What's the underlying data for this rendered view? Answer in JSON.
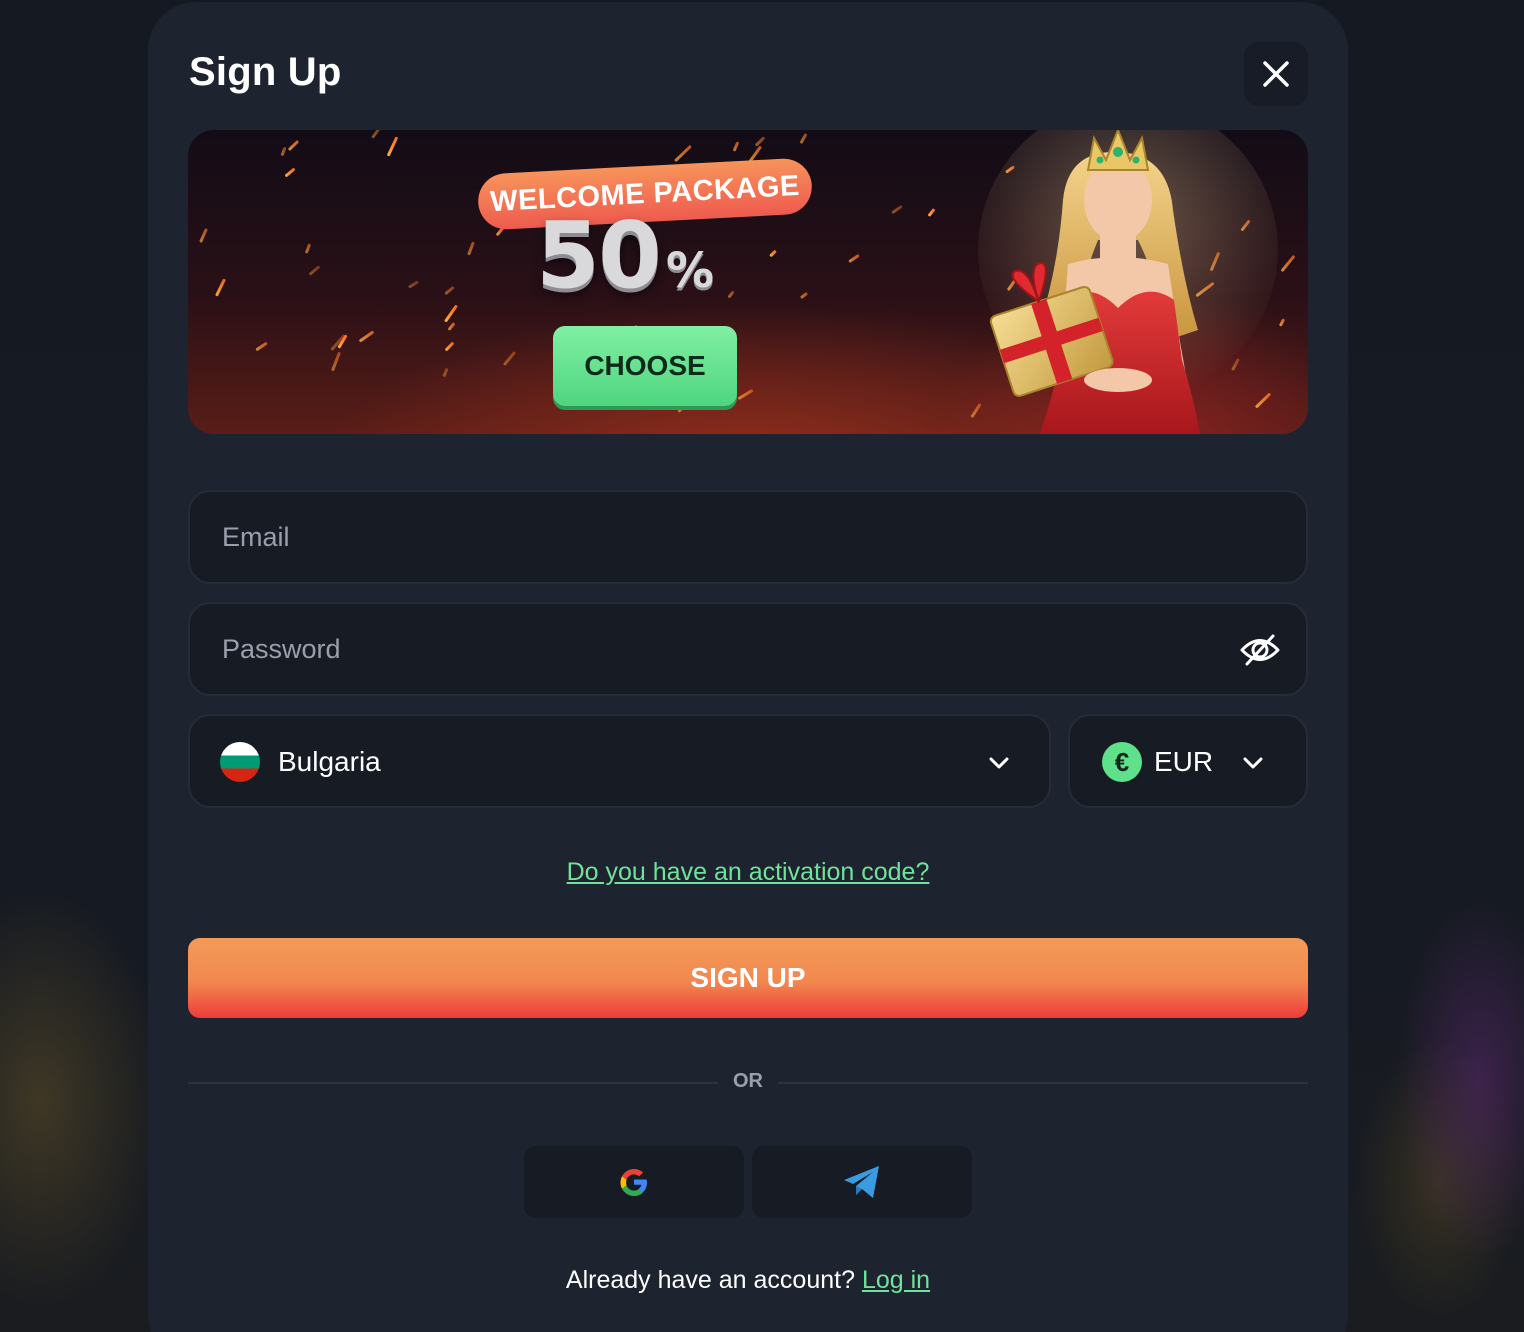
{
  "dialog": {
    "title": "Sign Up",
    "close_icon": "close-icon"
  },
  "banner": {
    "ribbon_text": "WELCOME PACKAGE",
    "percent_value": "50",
    "percent_sign": "%",
    "cta_label": "CHOOSE",
    "image": "woman-with-crown-holding-gift"
  },
  "form": {
    "email": {
      "placeholder": "Email",
      "value": ""
    },
    "password": {
      "placeholder": "Password",
      "value": "",
      "toggle_icon": "eye-slash-icon"
    },
    "country": {
      "value": "Bulgaria",
      "flag_icon": "bulgaria-flag-icon"
    },
    "currency": {
      "value": "EUR",
      "icon": "euro-icon",
      "symbol": "€"
    },
    "activation_link": "Do you have an activation code?",
    "submit_label": "SIGN UP"
  },
  "divider": {
    "text": "OR"
  },
  "social": [
    {
      "icon": "google-icon"
    },
    {
      "icon": "telegram-icon"
    }
  ],
  "footer": {
    "prompt": "Already have an account?",
    "login_link": "Log in"
  },
  "colors": {
    "accent_green": "#6fe39a",
    "signup_orange": "#f2884f",
    "signup_red": "#ec3c3a",
    "modal_bg": "#1e2330",
    "field_bg": "#171b24"
  }
}
